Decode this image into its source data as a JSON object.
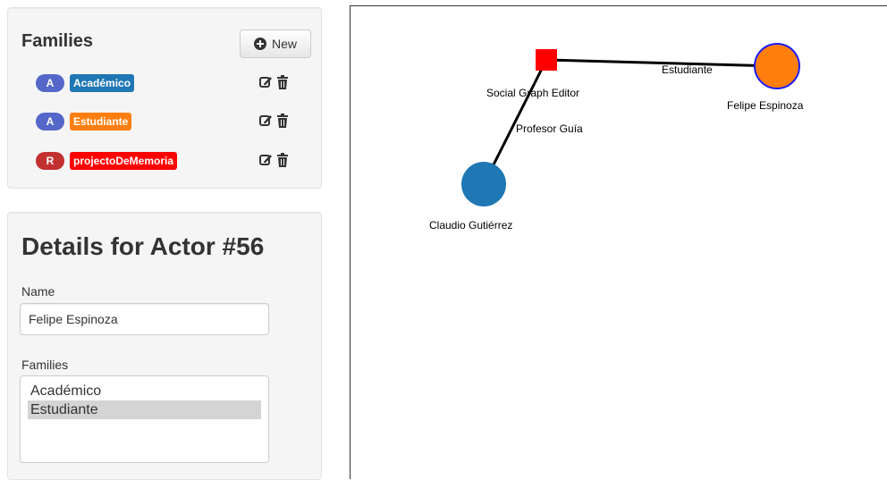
{
  "families_panel": {
    "title": "Families",
    "new_button_label": "New",
    "items": [
      {
        "type": "A",
        "type_color": "#5567c9",
        "name": "Académico",
        "color": "#1f77b4"
      },
      {
        "type": "A",
        "type_color": "#5567c9",
        "name": "Estudiante",
        "color": "#ff7f0e"
      },
      {
        "type": "R",
        "type_color": "#c33030",
        "name": "projectoDeMemoria",
        "color": "#ff0000"
      }
    ],
    "edit_icon": "edit-icon",
    "delete_icon": "trash-icon"
  },
  "details_panel": {
    "title": "Details for Actor #56",
    "name_label": "Name",
    "name_value": "Felipe Espinoza",
    "families_label": "Families",
    "families_options": [
      "Académico",
      "Estudiante"
    ],
    "families_selected": "Estudiante"
  },
  "graph": {
    "nodes": [
      {
        "label": "Social Graph Editor",
        "shape": "square",
        "color": "#ff0000"
      },
      {
        "label": "Felipe Espinoza",
        "shape": "circle",
        "color": "#ff7f0e",
        "stroke": "#1a1aff"
      },
      {
        "label": "Claudio Gutiérrez",
        "shape": "circle",
        "color": "#1f77b4"
      }
    ],
    "edges": [
      {
        "label": "Estudiante"
      },
      {
        "label": "Profesor Guía"
      }
    ]
  }
}
